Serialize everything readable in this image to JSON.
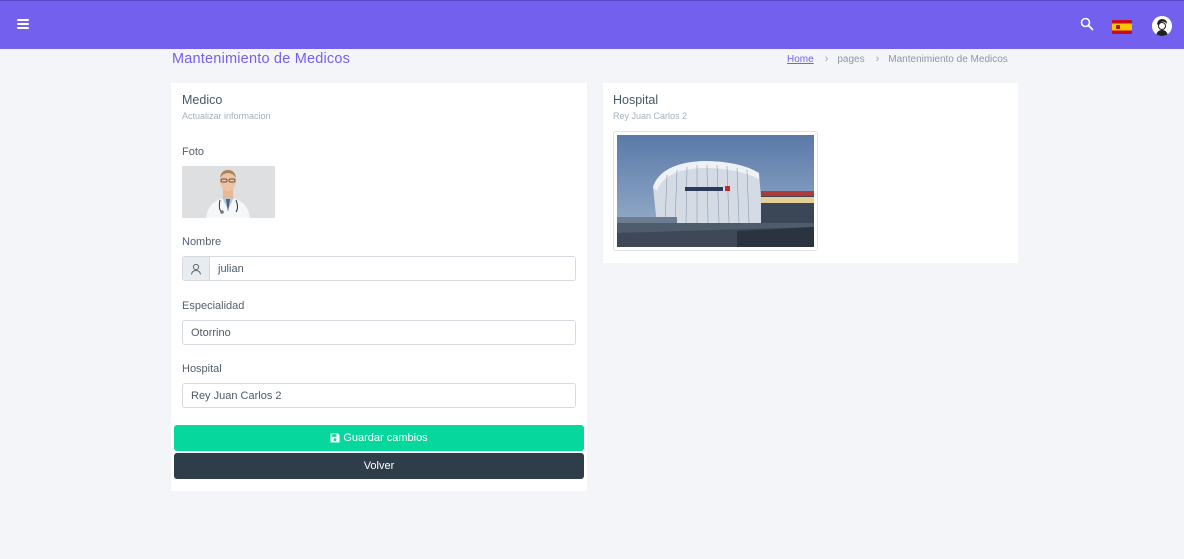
{
  "header": {
    "menu_icon": "hamburger-icon",
    "search_icon": "search-icon",
    "language_flag": "spain-flag-icon",
    "accent_color": "#7460ee"
  },
  "page": {
    "title": "Mantenimiento de Medicos",
    "breadcrumb": {
      "home": "Home",
      "pages": "pages",
      "current": "Mantenimiento de Medicos"
    }
  },
  "medico_card": {
    "title": "Medico",
    "subtitle": "Actualizar informacion",
    "photo_label": "Foto",
    "nombre_label": "Nombre",
    "nombre_value": "julian",
    "especialidad_label": "Especialidad",
    "especialidad_value": "Otorrino",
    "hospital_label": "Hospital",
    "hospital_value": "Rey Juan Carlos 2",
    "save_label": "Guardar cambios",
    "back_label": "Volver",
    "save_color": "#06d79c",
    "back_color": "#2f3d4a"
  },
  "hospital_card": {
    "title": "Hospital",
    "subtitle": "Rey Juan Carlos 2"
  }
}
